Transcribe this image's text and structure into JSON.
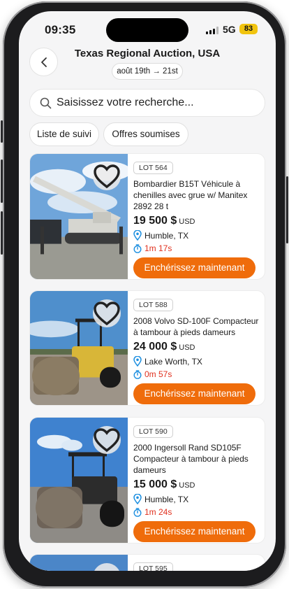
{
  "status_bar": {
    "time": "09:35",
    "network": "5G",
    "battery": "83"
  },
  "header": {
    "back_icon": "chevron-left-icon",
    "title": "Texas Regional Auction, USA",
    "date_range": "août 19th → 21st"
  },
  "search": {
    "placeholder": "Saisissez votre recherche...",
    "icon": "search-icon"
  },
  "filters": [
    "Liste de suivi",
    "Offres soumises"
  ],
  "accent_color": "#ef6c0b",
  "timer_color": "#e0301e",
  "lots": [
    {
      "lot": "LOT 564",
      "title": "Bombardier B15T Véhicule à chenilles avec grue w/ Manitex 2892 28 t",
      "price": "19 500 $",
      "currency": "USD",
      "location": "Humble, TX",
      "time_left": "1m 17s",
      "cta": "Enchérissez maintenant"
    },
    {
      "lot": "LOT 588",
      "title": "2008 Volvo SD-100F Compacteur à tambour à pieds dameurs",
      "price": "24 000 $",
      "currency": "USD",
      "location": "Lake Worth, TX",
      "time_left": "0m 57s",
      "cta": "Enchérissez maintenant"
    },
    {
      "lot": "LOT 590",
      "title": "2000 Ingersoll Rand SD105F Compacteur à tambour à pieds dameurs",
      "price": "15 000 $",
      "currency": "USD",
      "location": "Humble, TX",
      "time_left": "1m 24s",
      "cta": "Enchérissez maintenant"
    },
    {
      "lot": "LOT 595"
    }
  ]
}
